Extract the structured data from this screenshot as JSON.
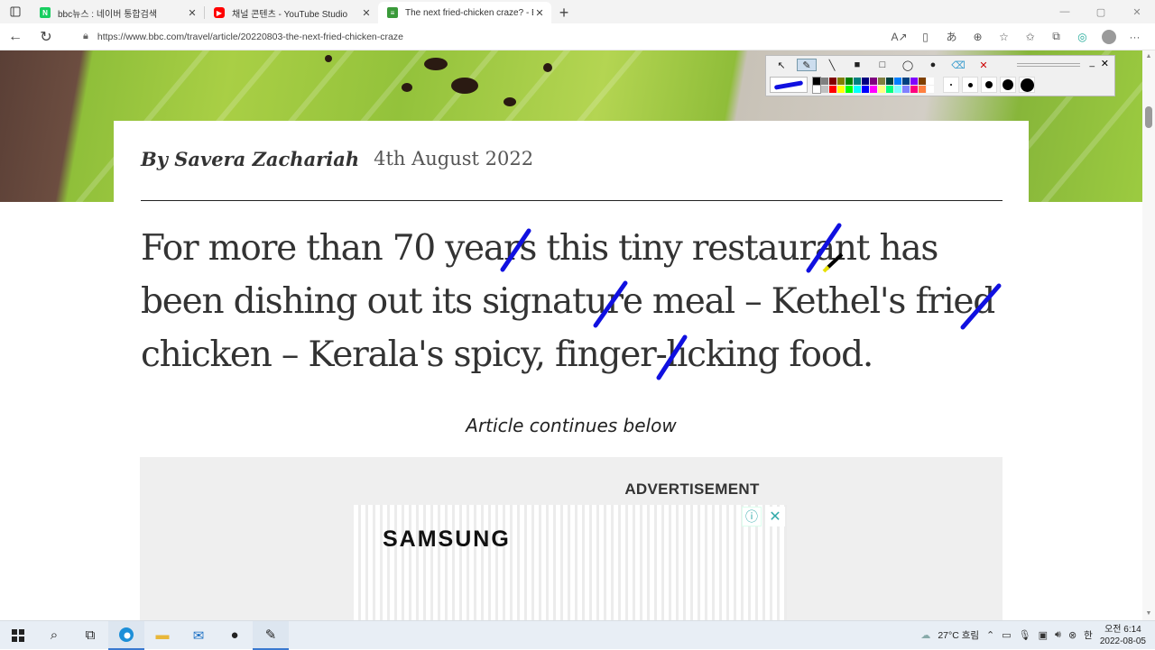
{
  "tabs": [
    {
      "title": "bbc뉴스 : 네이버 통합검색",
      "favicon_letter": "N",
      "favicon_color": "#19ce60",
      "active": false
    },
    {
      "title": "채널 콘텐츠 - YouTube Studio",
      "favicon_letter": "▶",
      "favicon_color": "#ff0000",
      "active": false
    },
    {
      "title": "The next fried-chicken craze? - B",
      "favicon_letter": "≡",
      "favicon_color": "#3a9a3a",
      "active": true
    }
  ],
  "new_tab_label": "+",
  "window_controls": [
    "—",
    "▢",
    "✕"
  ],
  "address": {
    "url": "https://www.bbc.com/travel/article/20220803-the-next-fried-chicken-craze"
  },
  "toolbar_icons": [
    "read-aloud-icon",
    "immersive-reader-icon",
    "translate-icon",
    "zoom-icon",
    "favorite-add-icon",
    "favorites-icon",
    "collections-icon",
    "extension-icon",
    "profile-icon",
    "more-icon"
  ],
  "article": {
    "author": "By Savera Zachariah",
    "date": "4th August 2022",
    "lede": "For more than 70 years this tiny restaurant has been dishing out its signature meal – Kethel's fried chicken – Kerala's spicy, finger-licking food.",
    "continues": "Article continues below",
    "ad_label": "ADVERTISEMENT",
    "ad_brand": "SAMSUNG"
  },
  "pen_palette": [
    "#000000",
    "#808080",
    "#800000",
    "#808000",
    "#008000",
    "#008080",
    "#000080",
    "#800080",
    "#808040",
    "#004040",
    "#0080ff",
    "#004080",
    "#8000ff",
    "#804000",
    "#ffffff",
    "#ffffff",
    "#c0c0c0",
    "#ff0000",
    "#ffff00",
    "#00ff00",
    "#00ffff",
    "#0000ff",
    "#ff00ff",
    "#ffff80",
    "#00ff80",
    "#80ffff",
    "#8080ff",
    "#ff0080",
    "#ff8040",
    "#ffffff"
  ],
  "taskbar": {
    "weather": "27°C  흐림",
    "ime": "한",
    "time": "오전 6:14",
    "date": "2022-08-05"
  },
  "colors": {
    "annotation": "#1010e0",
    "accent": "#3a79d0"
  }
}
